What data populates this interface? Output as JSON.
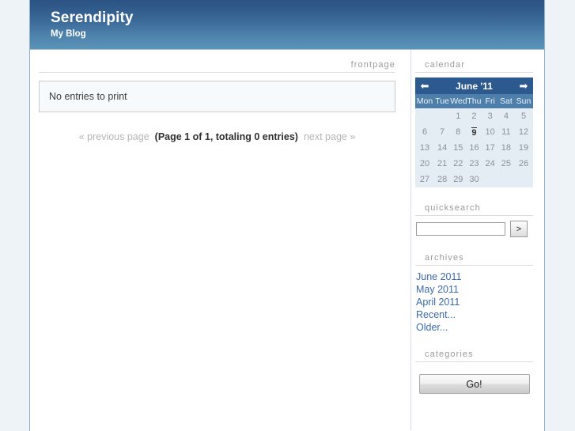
{
  "banner": {
    "title": "Serendipity",
    "subtitle": "My Blog"
  },
  "content": {
    "section_label": "frontpage",
    "entry_message": "No entries to print",
    "pagination": {
      "previous": "« previous page",
      "counter": "(Page 1 of 1, totaling 0 entries)",
      "next": "next page »"
    }
  },
  "sidebar": {
    "calendar": {
      "label": "calendar",
      "prev_icon": "⬅",
      "next_icon": "➡",
      "title": "June '11",
      "day_headers": [
        "Mon",
        "Tue",
        "Wed",
        "Thu",
        "Fri",
        "Sat",
        "Sun"
      ],
      "weeks": [
        [
          "",
          "",
          "1",
          "2",
          "3",
          "4",
          "5"
        ],
        [
          "6",
          "7",
          "8",
          "9",
          "10",
          "11",
          "12"
        ],
        [
          "13",
          "14",
          "15",
          "16",
          "17",
          "18",
          "19"
        ],
        [
          "20",
          "21",
          "22",
          "23",
          "24",
          "25",
          "26"
        ],
        [
          "27",
          "28",
          "29",
          "30",
          "",
          "",
          ""
        ]
      ],
      "today": "9"
    },
    "quicksearch": {
      "label": "quicksearch",
      "input_value": "",
      "input_placeholder": "",
      "submit_label": ">"
    },
    "archives": {
      "label": "archives",
      "items": [
        "June 2011",
        "May 2011",
        "April 2011",
        "Recent...",
        "Older..."
      ]
    },
    "categories": {
      "label": "categories",
      "go_label": "Go!"
    }
  },
  "colors": {
    "banner_top": "#2b5383",
    "banner_bottom": "#5b93b8",
    "calendar_nav": "#2d5a8e",
    "calendar_dow": "#4e7fab",
    "calendar_body": "#e4ecf4",
    "link": "#3c6aa8",
    "page_bg": "#eef3f7"
  }
}
